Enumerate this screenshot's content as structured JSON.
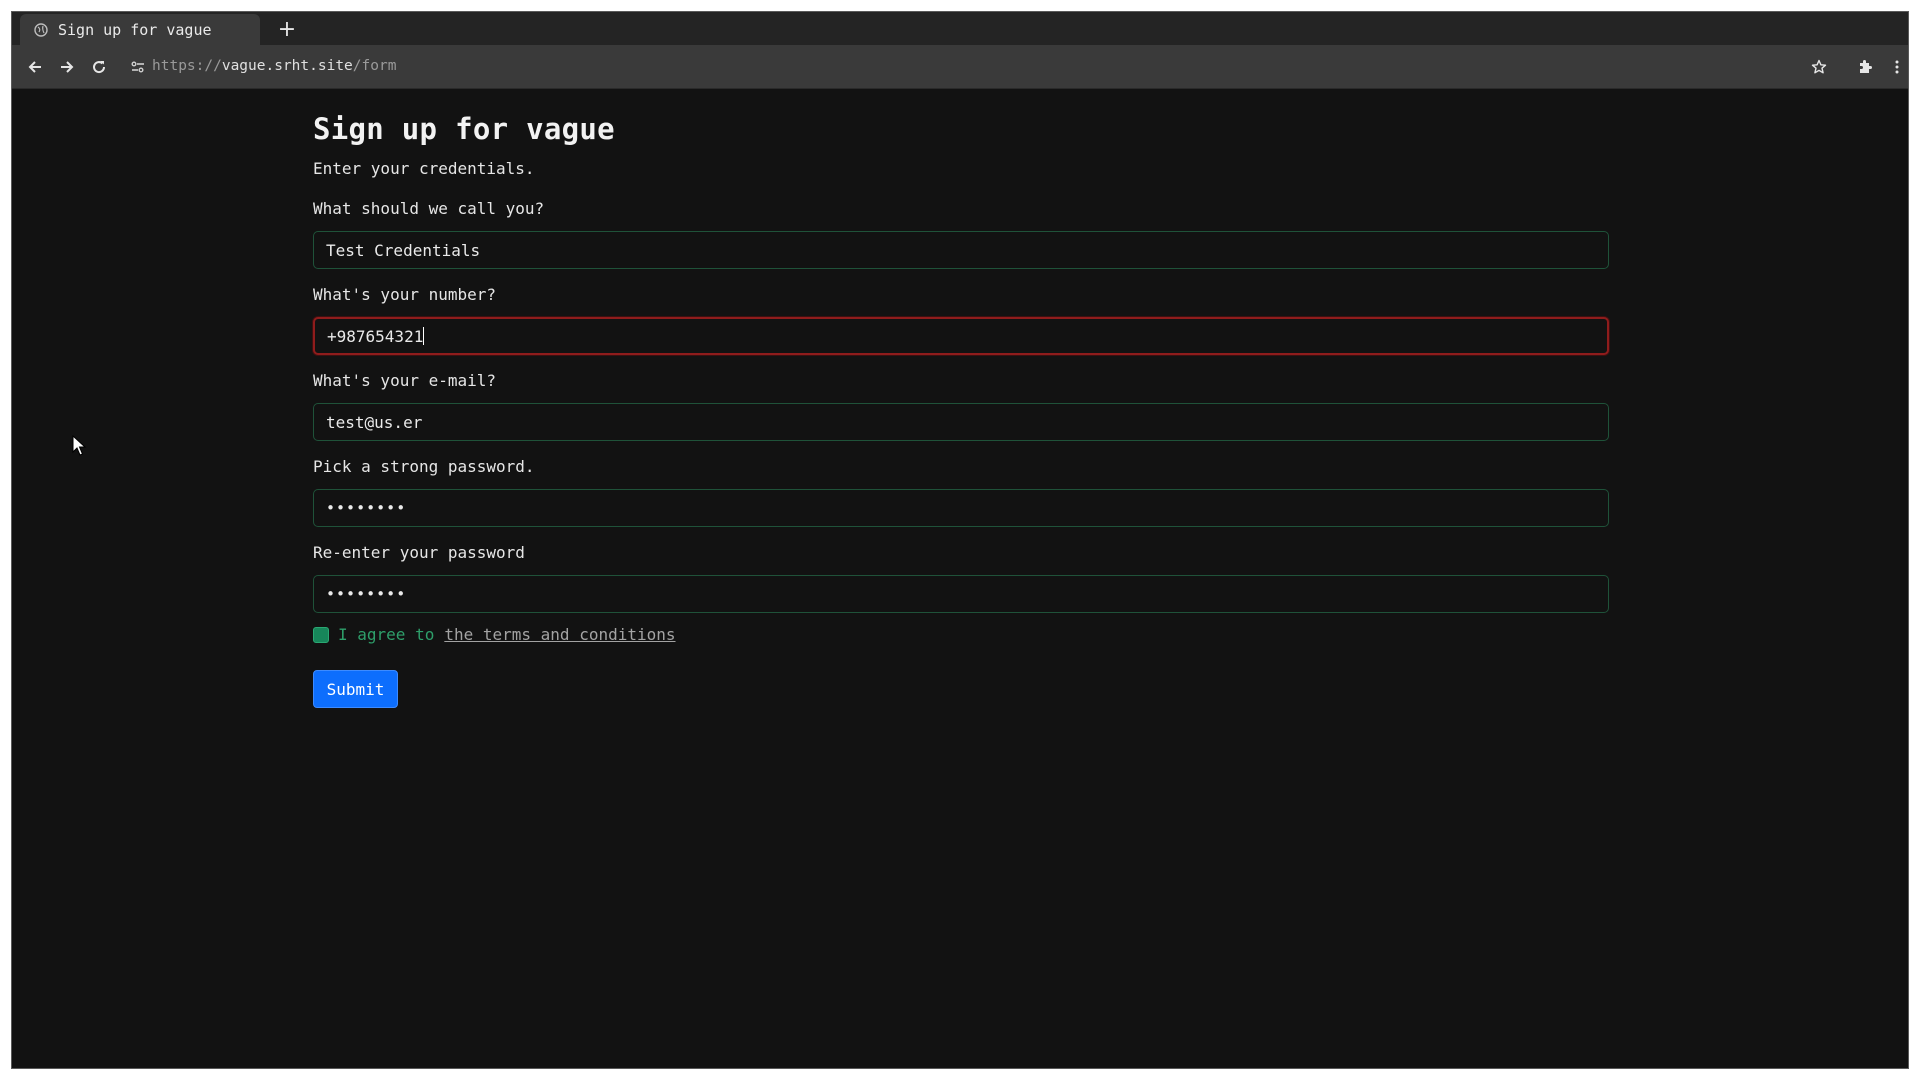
{
  "browser": {
    "tab_title": "Sign up for vague",
    "new_tab_label": "+",
    "url_scheme": "https://",
    "url_host": "vague.srht.site",
    "url_path": "/form"
  },
  "page": {
    "title": "Sign up for vague",
    "subtitle": "Enter your credentials."
  },
  "form": {
    "name_label": "What should we call you?",
    "name_value": "Test Credentials",
    "number_label": "What's your number?",
    "number_value": "+987654321",
    "email_label": "What's your e-mail?",
    "email_value": "test@us.er",
    "password_label": "Pick a strong password.",
    "password_value": "••••••••",
    "reenter_label": "Re-enter your password",
    "reenter_value": "••••••••",
    "agree_text": "I agree to",
    "terms_link": "the terms and conditions",
    "submit_label": "Submit"
  },
  "colors": {
    "background": "#121212",
    "input_border": "#1f5239",
    "invalid_border": "#8f1c1c",
    "submit": "#0d6efd",
    "checkbox": "#17865a"
  }
}
